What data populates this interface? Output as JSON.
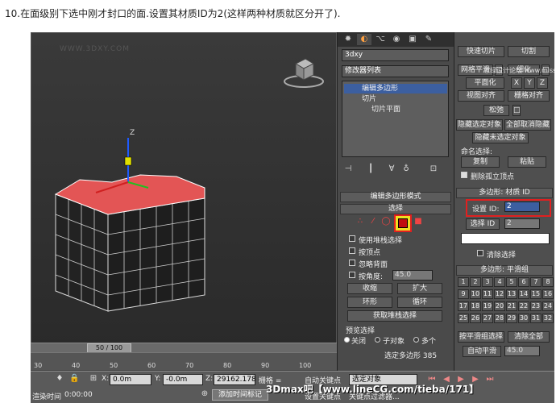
{
  "caption": "10.在面级别下选中刚才封口的面.设置其材质ID为2(这样两种材质就区分开了).",
  "viewport": {
    "watermark": "WWW.3DXY.COM",
    "axis_z": "Z"
  },
  "timeline": {
    "frame_display": "50 / 100",
    "ticks": [
      "30",
      "40",
      "50",
      "60",
      "70",
      "80",
      "90",
      "100"
    ]
  },
  "status": {
    "x_label": "X:",
    "x_value": "0.0m",
    "y_label": "Y:",
    "y_value": "-0.0m",
    "z_label": "Z:",
    "z_value": "29162.178",
    "grid_label": "栅格 =",
    "render_time_label": "渲染时间",
    "render_time_value": "0:00:00",
    "add_time_tag": "添加时间标记",
    "auto_key": "自动关键点",
    "set_key": "设置关键点",
    "selected_object": "选定对象",
    "key_filters": "关键点过滤器..."
  },
  "command_panel": {
    "tabs": [
      "create",
      "modify",
      "hierarchy",
      "motion",
      "display",
      "utilities"
    ],
    "object_name": "3dxy",
    "modifier_list": "修改器列表",
    "stack": {
      "edit_poly": "编辑多边形",
      "slice": "切片",
      "slice_plane": "切片平面"
    },
    "edit_poly_mode": "编辑多边形模式",
    "selection_title": "选择",
    "use_stack_selection": "使用堆栈选择",
    "by_vertex": "按顶点",
    "ignore_backfacing": "忽略背面",
    "by_angle": "按角度:",
    "angle_value": "45.0",
    "shrink": "收缩",
    "grow": "扩大",
    "ring": "环形",
    "loop": "循环",
    "get_stack_selection": "获取堆栈选择",
    "preview_selection": "预览选择",
    "preview_off": "关闭",
    "preview_subobj": "子对象",
    "preview_multi": "多个",
    "selected_count": "选定多边形 385"
  },
  "right_panel": {
    "watermark": "思绿设计论坛 www.missyuan.com",
    "quick_slice": "快速切片",
    "cut": "切割",
    "msmooth": "网格平滑",
    "tessellate": "细化",
    "make_planar": "平面化",
    "x": "X",
    "y": "Y",
    "z": "Z",
    "view_align": "视图对齐",
    "grid_align": "栅格对齐",
    "relax": "松弛",
    "hide_selected": "隐藏选定对象",
    "unhide_all": "全部取消隐藏",
    "hide_unselected": "隐藏未选定对象",
    "named_selections": "命名选择:",
    "copy": "复制",
    "paste": "粘贴",
    "delete_isolated": "删除孤立顶点",
    "material_ids_title": "多边形: 材质 ID",
    "set_id_label": "设置 ID:",
    "set_id_value": "2",
    "select_id": "选择 ID",
    "select_id_value": "2",
    "clear_selection": "清除选择",
    "smoothing_title": "多边形: 平滑组",
    "smoothing_groups": [
      "1",
      "2",
      "3",
      "4",
      "5",
      "6",
      "7",
      "8",
      "9",
      "10",
      "11",
      "12",
      "13",
      "14",
      "15",
      "16",
      "17",
      "18",
      "19",
      "20",
      "21",
      "22",
      "23",
      "24",
      "25",
      "26",
      "27",
      "28",
      "29",
      "30",
      "31",
      "32"
    ],
    "select_by_sg": "按平滑组选择",
    "clear_all": "清除全部",
    "auto_smooth": "自动平滑",
    "auto_smooth_value": "45.0"
  },
  "bottom_watermark": "3Dmax吧【www.lineCG.com/tieba/171】",
  "colors": {
    "highlight_red": "#e12020",
    "cap_red": "#e35555",
    "selection_yellow": "#f0e020"
  }
}
